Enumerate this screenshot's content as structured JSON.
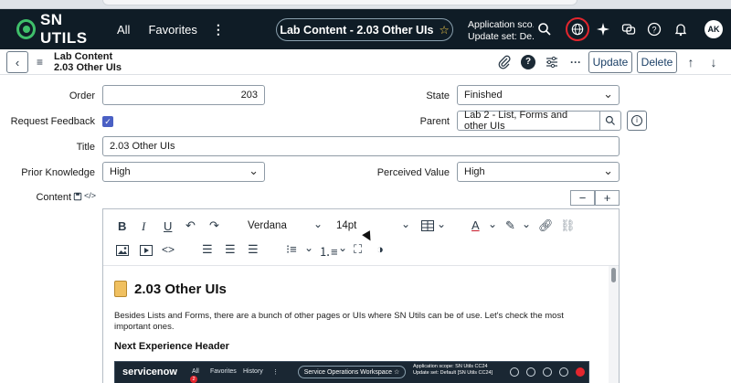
{
  "topnav": {
    "logo": "SN UTILS",
    "links": [
      "All",
      "Favorites"
    ],
    "more": "⋮",
    "record_pill": "Lab Content - 2.03 Other UIs",
    "scope_line1": "Application sco...",
    "scope_line2": "Update set: De...",
    "avatar": "AK"
  },
  "formbar": {
    "title_line1": "Lab Content",
    "title_line2": "2.03 Other UIs",
    "update_label": "Update",
    "delete_label": "Delete"
  },
  "form": {
    "order_label": "Order",
    "order_value": "203",
    "state_label": "State",
    "state_value": "Finished",
    "request_feedback_label": "Request Feedback",
    "request_feedback_checked": true,
    "parent_label": "Parent",
    "parent_value": "Lab 2 - List, Forms and other UIs",
    "title_label": "Title",
    "title_value": "2.03 Other UIs",
    "prior_knowledge_label": "Prior Knowledge",
    "prior_knowledge_value": "High",
    "perceived_value_label": "Perceived Value",
    "perceived_value_value": "High",
    "content_label": "Content"
  },
  "editor": {
    "font_family": "Verdana",
    "font_size": "14pt",
    "heading": "2.03 Other UIs",
    "paragraph": "Besides Lists and Forms, there are a bunch of other pages or UIs where SN Utils can be of use. Let's check the most important ones.",
    "subheading": "Next Experience Header",
    "embed": {
      "brand": "servicenow",
      "links": [
        "All",
        "Favorites",
        "History"
      ],
      "badge": "2",
      "pill": "Service Operations Workspace ☆",
      "scope_line1": "Application scope: SN Utils CC24",
      "scope_line2": "Update set: Default [SN Utils CC24]"
    }
  },
  "colors": {
    "nav_bg": "#0f1c26",
    "logo_green": "#3fbf6a",
    "highlight_red": "#e3262e",
    "checkbox_blue": "#4a60c4"
  }
}
